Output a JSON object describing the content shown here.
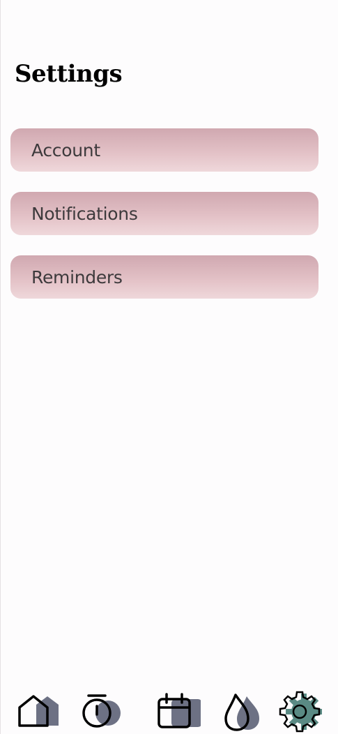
{
  "page": {
    "title": "Settings"
  },
  "settings": {
    "items": [
      {
        "label": "Account"
      },
      {
        "label": "Notifications"
      },
      {
        "label": "Reminders"
      }
    ]
  },
  "bottom_nav": {
    "items": [
      {
        "icon": "home-icon",
        "active": false
      },
      {
        "icon": "timer-icon",
        "active": false
      },
      {
        "icon": "calendar-icon",
        "active": false
      },
      {
        "icon": "flame-icon",
        "active": false
      },
      {
        "icon": "gear-icon",
        "active": true
      }
    ]
  },
  "colors": {
    "item_gradient_top": "#d0a8b0",
    "item_gradient_bottom": "#efd8db",
    "icon_shadow": "#6d7184",
    "icon_active_shadow": "#5a8a84",
    "background": "#fdfcfd"
  }
}
